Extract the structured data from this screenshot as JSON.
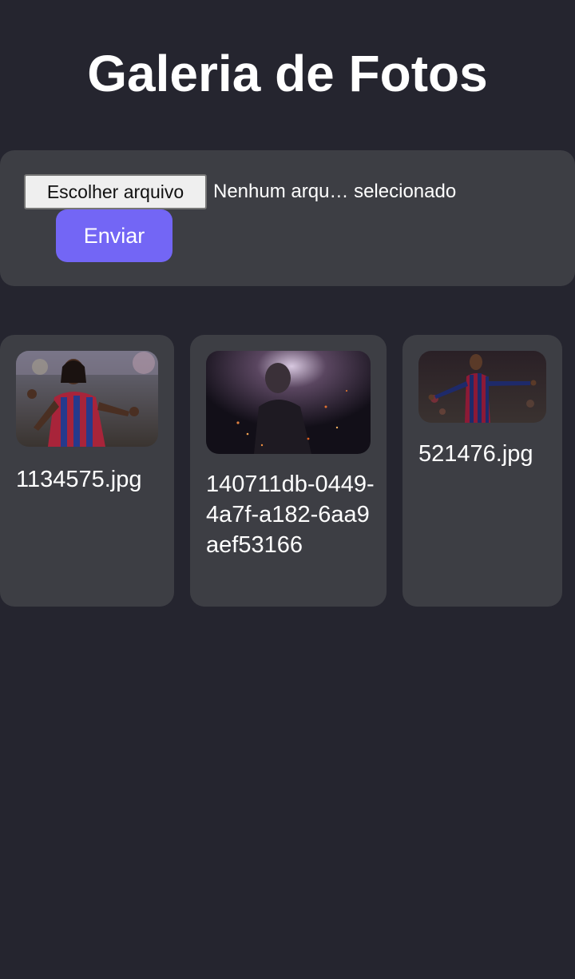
{
  "header": {
    "title": "Galeria de Fotos"
  },
  "upload": {
    "file_button_label": "Escolher arquivo",
    "file_status": "Nenhum arqu… selecionado",
    "send_label": "Enviar"
  },
  "gallery": {
    "photos": [
      {
        "filename": "1134575.jpg"
      },
      {
        "filename": "140711db-0449-4a7f-a182-6aa9aef53166"
      },
      {
        "filename": "521476.jpg"
      }
    ]
  },
  "colors": {
    "background": "#25252f",
    "panel": "#3d3e44",
    "accent": "#7366f5"
  }
}
